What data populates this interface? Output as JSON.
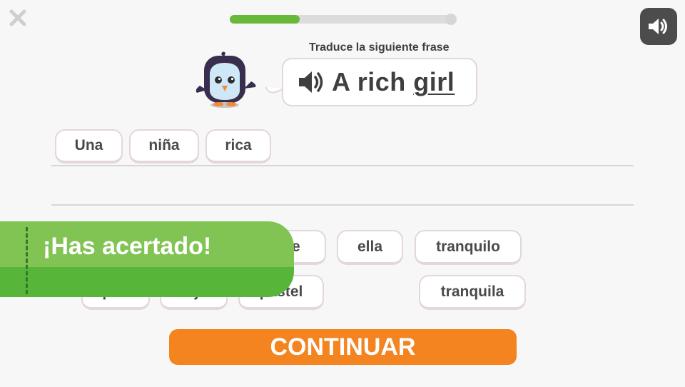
{
  "header": {
    "close_icon": "close-icon",
    "progress": 0.31,
    "progress_color": "#68b83a",
    "sound_icon": "speaker-icon"
  },
  "exercise": {
    "instruction": "Traduce la siguiente frase",
    "phrase_words": [
      "A",
      "rich",
      "girl"
    ],
    "highlighted_word": "girl",
    "speaker_icon": "speaker-icon"
  },
  "answer": {
    "selected_tiles": [
      "Una",
      "niña",
      "rica"
    ]
  },
  "word_bank": {
    "row1": [
      "ne",
      "ella",
      "tranquilo"
    ],
    "row2": [
      "pan",
      "rojo",
      "pastel",
      "tranquila"
    ]
  },
  "feedback": {
    "message": "¡Has acertado!",
    "color_light": "#82c454",
    "color_dark": "#57b53a"
  },
  "footer": {
    "continue_label": "CONTINUAR",
    "continue_color": "#f3841f"
  }
}
